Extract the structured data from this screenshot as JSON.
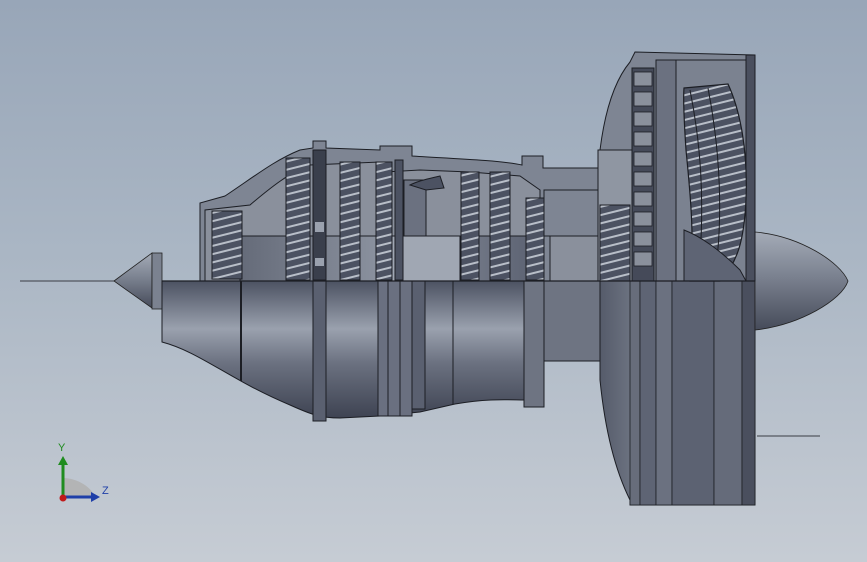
{
  "app": {
    "view": "CAD 3D viewport",
    "background_top": "#98a6b8",
    "background_bottom": "#c6ccd4"
  },
  "model": {
    "name": "turbofan-engine-section",
    "body_color": "#5e6474",
    "highlight_color": "#9aa1ae",
    "edge_color": "#1a1c22"
  },
  "triad": {
    "y_label": "Y",
    "z_label": "Z",
    "y_color": "#1f8c1f",
    "z_color": "#1f3fa8",
    "origin_color": "#c01a1a",
    "x_color": "#b0b0b0"
  }
}
